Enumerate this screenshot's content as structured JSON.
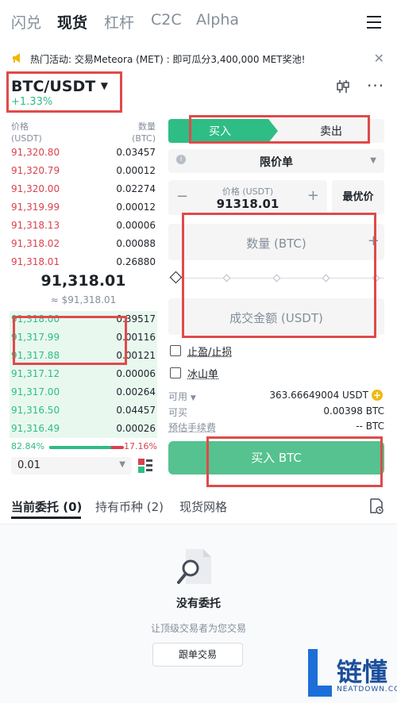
{
  "top_tabs": [
    "闪兑",
    "现货",
    "杠杆",
    "C2C",
    "Alpha"
  ],
  "banner": {
    "text": "热门活动: 交易Meteora (MET)  : 即可瓜分3,400,000 MET奖池!"
  },
  "pair": {
    "symbol": "BTC/USDT",
    "change": "+1.33%"
  },
  "orderbook": {
    "price_header": "价格",
    "price_unit": "(USDT)",
    "qty_header": "数量",
    "qty_unit": "(BTC)",
    "asks": [
      {
        "price": "91,320.80",
        "qty": "0.03457"
      },
      {
        "price": "91,320.79",
        "qty": "0.00012"
      },
      {
        "price": "91,320.00",
        "qty": "0.02274"
      },
      {
        "price": "91,319.99",
        "qty": "0.00012"
      },
      {
        "price": "91,318.13",
        "qty": "0.00006"
      },
      {
        "price": "91,318.02",
        "qty": "0.00088"
      },
      {
        "price": "91,318.01",
        "qty": "0.26880"
      }
    ],
    "last_price": "91,318.01",
    "last_price_usd": "≈ $91,318.01",
    "bids": [
      {
        "price": "91,318.00",
        "qty": "0.39517"
      },
      {
        "price": "91,317.99",
        "qty": "0.00116"
      },
      {
        "price": "91,317.88",
        "qty": "0.00121"
      },
      {
        "price": "91,317.12",
        "qty": "0.00006"
      },
      {
        "price": "91,317.00",
        "qty": "0.00264"
      },
      {
        "price": "91,316.50",
        "qty": "0.04457"
      },
      {
        "price": "91,316.49",
        "qty": "0.00026"
      }
    ],
    "buy_ratio": "82.84%",
    "sell_ratio": "17.16%",
    "buy_fraction": 0.8284,
    "precision": "0.01"
  },
  "form": {
    "buy_label": "买入",
    "sell_label": "卖出",
    "order_type": "限价单",
    "price_label": "价格 (USDT)",
    "price_value": "91318.01",
    "best_price": "最优价",
    "qty_placeholder": "数量 (BTC)",
    "amount_placeholder": "成交金额 (USDT)",
    "tp_sl": "止盈/止损",
    "iceberg": "冰山单",
    "available_label": "可用",
    "available_value": "363.66649004 USDT",
    "can_buy_label": "可买",
    "can_buy_value": "0.00398 BTC",
    "fee_label": "预估手续费",
    "fee_value": "-- BTC",
    "submit": "买入 BTC"
  },
  "bottom_tabs": {
    "orders": "当前委托 (0)",
    "holdings": "持有币种 (2)",
    "grid": "现货网格"
  },
  "empty": {
    "title": "没有委托",
    "subtitle": "让顶级交易者为您交易",
    "button": "跟单交易"
  },
  "watermark": {
    "text": "链懂",
    "sub": "NEATDOWN.COM"
  },
  "colors": {
    "green": "#2ebd85",
    "red": "#d9424e",
    "highlight": "#e04a4a"
  }
}
